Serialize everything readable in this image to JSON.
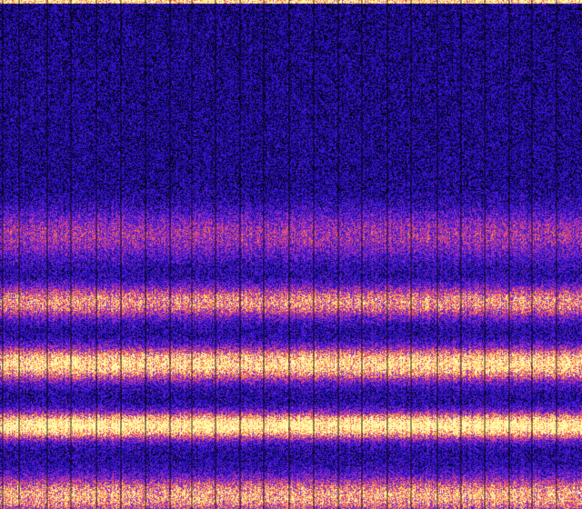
{
  "chart_data": {
    "type": "heatmap",
    "title": "",
    "xlabel": "",
    "ylabel": "",
    "colormap": [
      "#000000",
      "#1a0cb3",
      "#4a19d6",
      "#9b2fc9",
      "#e0407a",
      "#ff8c3a",
      "#ffe27a",
      "#fffbb0"
    ],
    "grid": true,
    "column_count": 640,
    "row_count": 560,
    "divider_columns": [
      3,
      21,
      52,
      78,
      106,
      133,
      160,
      187,
      211,
      237,
      264,
      290,
      318,
      345,
      372,
      398,
      426,
      452,
      481,
      507,
      533,
      560,
      585,
      612
    ],
    "bands": [
      {
        "row_center": 258,
        "row_half_width": 22,
        "intensity": 0.3
      },
      {
        "row_center": 332,
        "row_half_width": 14,
        "intensity": 0.55
      },
      {
        "row_center": 400,
        "row_half_width": 14,
        "intensity": 0.8
      },
      {
        "row_center": 468,
        "row_half_width": 11,
        "intensity": 0.95
      },
      {
        "row_center": 545,
        "row_half_width": 16,
        "intensity": 0.6
      }
    ],
    "background_intensity": 0.12,
    "bright_top_edge": true
  }
}
